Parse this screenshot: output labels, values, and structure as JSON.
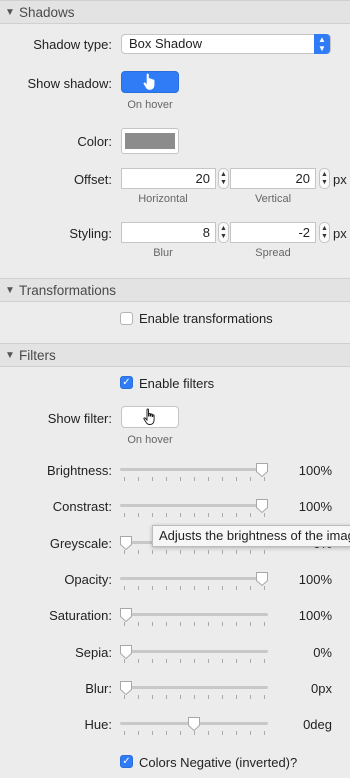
{
  "shadows": {
    "header": "Shadows",
    "type_label": "Shadow type:",
    "type_value": "Box Shadow",
    "show_label": "Show shadow:",
    "show_caption": "On hover",
    "color_label": "Color:",
    "color_value": "#8c8c8c",
    "offset_label": "Offset:",
    "offset_h": "20",
    "offset_v": "20",
    "offset_h_caption": "Horizontal",
    "offset_v_caption": "Vertical",
    "styling_label": "Styling:",
    "blur": "8",
    "spread": "-2",
    "blur_caption": "Blur",
    "spread_caption": "Spread",
    "unit": "px"
  },
  "transformations": {
    "header": "Transformations",
    "enable_label": "Enable transformations",
    "enabled": false
  },
  "filters": {
    "header": "Filters",
    "enable_label": "Enable filters",
    "enabled": true,
    "show_label": "Show filter:",
    "show_caption": "On hover",
    "sliders": [
      {
        "label": "Brightness:",
        "value": "100%",
        "position": 0.96
      },
      {
        "label": "Constrast:",
        "value": "100%",
        "position": 0.96
      },
      {
        "label": "Greyscale:",
        "value": "0%",
        "position": 0.04
      },
      {
        "label": "Opacity:",
        "value": "100%",
        "position": 0.96
      },
      {
        "label": "Saturation:",
        "value": "100%",
        "position": 0.04
      },
      {
        "label": "Sepia:",
        "value": "0%",
        "position": 0.04
      },
      {
        "label": "Blur:",
        "value": "0px",
        "position": 0.04
      },
      {
        "label": "Hue:",
        "value": "0deg",
        "position": 0.5
      }
    ],
    "negative_label": "Colors Negative  (inverted)?",
    "negative_checked": true
  },
  "tooltip": "Adjusts the brightness of the image"
}
